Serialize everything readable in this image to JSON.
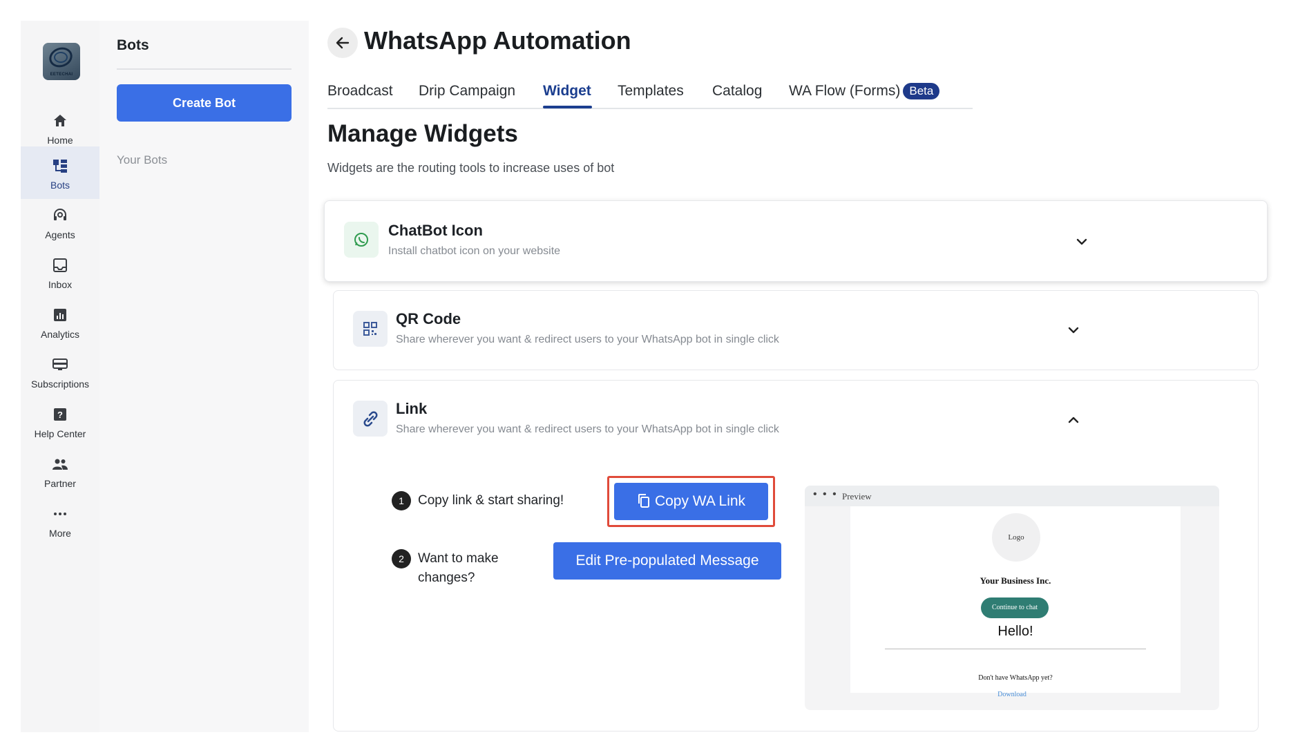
{
  "rail": {
    "logo_text": "EETECHAI",
    "items": [
      {
        "label": "Home",
        "icon": "home-icon"
      },
      {
        "label": "Bots",
        "icon": "bots-icon",
        "active": true
      },
      {
        "label": "Agents",
        "icon": "headset-icon"
      },
      {
        "label": "Inbox",
        "icon": "inbox-icon"
      },
      {
        "label": "Analytics",
        "icon": "analytics-icon"
      },
      {
        "label": "Subscriptions",
        "icon": "subscriptions-icon"
      },
      {
        "label": "Help Center",
        "icon": "help-icon"
      },
      {
        "label": "Partner",
        "icon": "partner-icon"
      },
      {
        "label": "More",
        "icon": "more-icon"
      }
    ]
  },
  "bots_panel": {
    "title": "Bots",
    "create_label": "Create Bot",
    "your_bots_label": "Your Bots"
  },
  "header": {
    "title": "WhatsApp Automation"
  },
  "tabs": [
    {
      "label": "Broadcast"
    },
    {
      "label": "Drip Campaign"
    },
    {
      "label": "Widget",
      "active": true
    },
    {
      "label": "Templates"
    },
    {
      "label": "Catalog"
    },
    {
      "label": "WA Flow (Forms)",
      "badge": "Beta"
    }
  ],
  "section": {
    "title": "Manage Widgets",
    "subtitle": "Widgets are the routing tools to increase uses of bot"
  },
  "widgets": [
    {
      "title": "ChatBot Icon",
      "desc": "Install chatbot icon on your website",
      "icon": "whatsapp-icon",
      "expanded": false
    },
    {
      "title": "QR Code",
      "desc": "Share wherever you want & redirect users to your WhatsApp bot in single click",
      "icon": "qr-code-icon",
      "expanded": false
    },
    {
      "title": "Link",
      "desc": "Share wherever you want & redirect users to your WhatsApp bot in single click",
      "icon": "link-icon",
      "expanded": true
    }
  ],
  "link_panel": {
    "step1_num": "1",
    "step1_text": "Copy link & start sharing!",
    "copy_label": "Copy WA Link",
    "step2_num": "2",
    "step2_text_line1": "Want to make",
    "step2_text_line2": "changes?",
    "edit_label": "Edit Pre-populated Message"
  },
  "preview": {
    "dots": "• • •",
    "label": "Preview",
    "logo": "Logo",
    "business": "Your Business Inc.",
    "continue_label": "Continue to chat",
    "message": "Hello!",
    "no_whatsapp": "Don't have WhatsApp yet?",
    "download": "Download"
  },
  "colors": {
    "primary": "#3a6fe6",
    "tab_active": "#1b3e8f",
    "highlight": "#e04b3a",
    "whatsapp_green": "#2f7d73"
  }
}
